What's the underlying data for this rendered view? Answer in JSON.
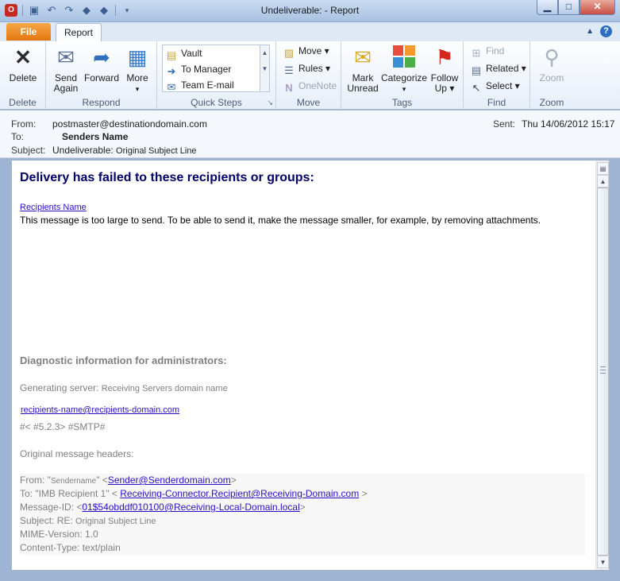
{
  "window": {
    "title": "Undeliverable: - Report",
    "minimize": "▁",
    "maximize": "□",
    "close": "✕"
  },
  "tabs": {
    "file": "File",
    "report": "Report"
  },
  "ribbon": {
    "groups": {
      "delete": "Delete",
      "respond": "Respond",
      "quick_steps": "Quick Steps",
      "move": "Move",
      "tags": "Tags",
      "find": "Find",
      "zoom": "Zoom"
    },
    "buttons": {
      "delete": "Delete",
      "send_again_1": "Send",
      "send_again_2": "Again",
      "forward": "Forward",
      "more": "More",
      "more_arrow": "▾",
      "mark_unread_1": "Mark",
      "mark_unread_2": "Unread",
      "categorize": "Categorize",
      "categorize_arrow": "▾",
      "follow_up_1": "Follow",
      "follow_up_2": "Up ▾",
      "zoom": "Zoom"
    },
    "quick_steps": [
      "Vault",
      "To Manager",
      "Team E-mail"
    ],
    "move_items": [
      "Move ▾",
      "Rules ▾",
      "OneNote"
    ],
    "find_items": [
      "Find",
      "Related ▾",
      "Select ▾"
    ]
  },
  "message": {
    "from_label": "From:",
    "from_value": "postmaster@destinationdomain.com",
    "to_label": "To:",
    "to_value": "Senders Name",
    "subject_label": "Subject:",
    "subject_prefix": "Undeliverable: ",
    "subject_value": "Original Subject Line",
    "sent_label": "Sent:",
    "sent_value": "Thu 14/06/2012 15:17"
  },
  "body": {
    "failure_title": "Delivery has failed to these recipients or groups:",
    "recipient_link": "Recipients Name",
    "failure_message": "This message is too large to send. To be able to send it, make the message smaller, for example, by removing attachments.",
    "diag_title": "Diagnostic information for administrators:",
    "generating_server_label": "Generating server: ",
    "generating_server_value": "Receiving Servers domain name",
    "recipient_email": "recipients-name@recipients-domain.com",
    "status_code": "#< #5.2.3> #SMTP#",
    "original_headers_label": "Original message headers:",
    "headers": {
      "from_label": "From: \"",
      "from_name": "Sendername",
      "from_mid": "\" <",
      "from_email": "Sender@Senderdomain.com",
      "from_end": ">",
      "to_label": "To: \"IMB Recipient 1\" <",
      "to_email": "Receiving-Connector.Recipient@Receiving-Domain.com",
      "to_end": ">",
      "msgid_label": "Message-ID: <",
      "msgid_value": "01$54obddf010100@Receiving-Local-Domain.local",
      "msgid_end": ">",
      "subject_label": "Subject: RE: ",
      "subject_value": "Original Subject Line",
      "mime": "MIME-Version: 1.0",
      "content_type": "Content-Type: text/plain"
    }
  },
  "icons": {
    "delete": "delete-x-icon",
    "send_again": "envelope-icon",
    "forward": "forward-envelope-icon",
    "more": "calendar-grid-icon",
    "mark_unread": "envelope-open-icon",
    "categorize": "color-squares-icon",
    "follow_up": "red-flag-icon",
    "zoom": "magnifier-icon"
  },
  "colors": {
    "file_tab": "#e2760d",
    "title_text": "#000066",
    "link": "#2a0fc4",
    "muted": "#808080"
  }
}
